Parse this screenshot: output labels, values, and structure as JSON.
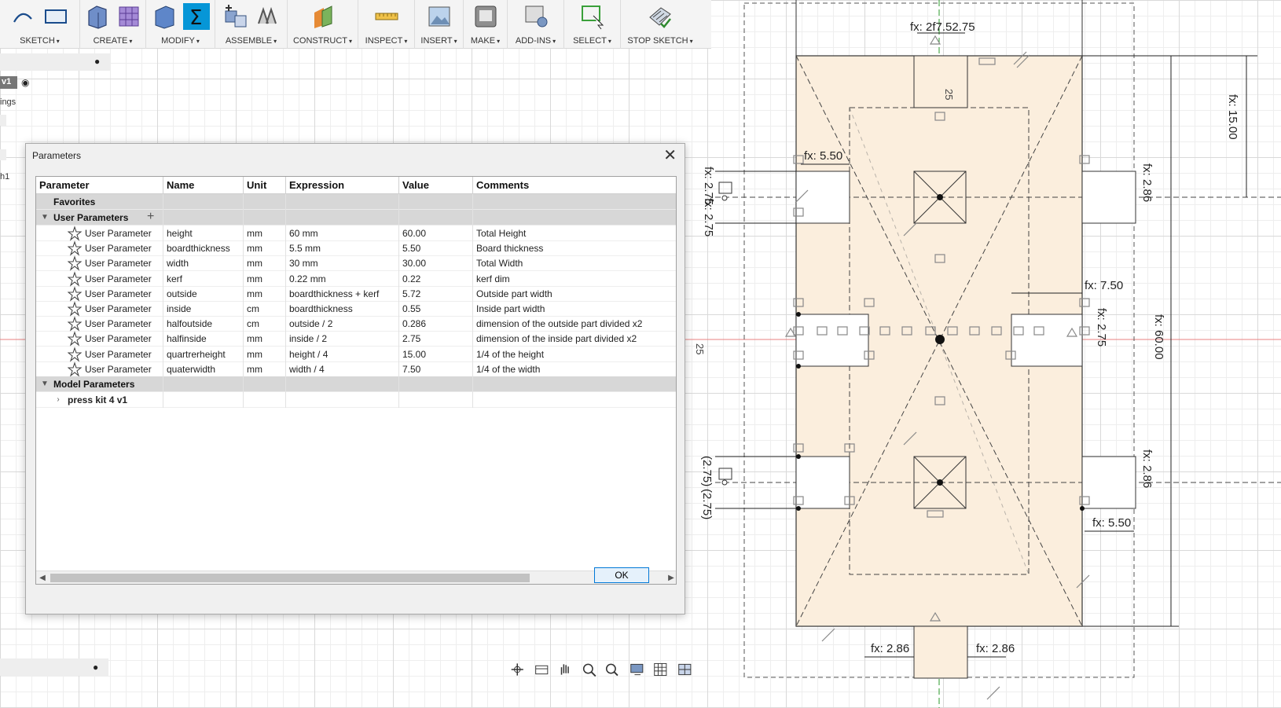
{
  "toolbar": {
    "groups": [
      {
        "label": "SKETCH"
      },
      {
        "label": "CREATE"
      },
      {
        "label": "MODIFY"
      },
      {
        "label": "ASSEMBLE"
      },
      {
        "label": "CONSTRUCT"
      },
      {
        "label": "INSPECT"
      },
      {
        "label": "INSERT"
      },
      {
        "label": "MAKE"
      },
      {
        "label": "ADD-INS"
      },
      {
        "label": "SELECT"
      },
      {
        "label": "STOP SKETCH"
      }
    ],
    "caret": "▾"
  },
  "browser": {
    "item_v1": "v1",
    "item_ings": "ings",
    "item_h1": "h1"
  },
  "dialog": {
    "title": "Parameters",
    "close": "✕",
    "ok_label": "OK",
    "columns": [
      "Parameter",
      "Name",
      "Unit",
      "Expression",
      "Value",
      "Comments"
    ],
    "favorites_label": "Favorites",
    "user_params_label": "User Parameters",
    "model_params_label": "Model Parameters",
    "model_item": "press kit 4 v1",
    "rows": [
      {
        "param": "User Parameter",
        "name": "height",
        "unit": "mm",
        "expr": "60 mm",
        "value": "60.00",
        "comment": "Total Height"
      },
      {
        "param": "User Parameter",
        "name": "boardthickness",
        "unit": "mm",
        "expr": "5.5 mm",
        "value": "5.50",
        "comment": "Board thickness"
      },
      {
        "param": "User Parameter",
        "name": "width",
        "unit": "mm",
        "expr": "30 mm",
        "value": "30.00",
        "comment": "Total Width"
      },
      {
        "param": "User Parameter",
        "name": "kerf",
        "unit": "mm",
        "expr": "0.22 mm",
        "value": "0.22",
        "comment": "kerf dim"
      },
      {
        "param": "User Parameter",
        "name": "outside",
        "unit": "mm",
        "expr": "boardthickness + kerf",
        "value": "5.72",
        "comment": "Outside part width"
      },
      {
        "param": "User Parameter",
        "name": "inside",
        "unit": "cm",
        "expr": "boardthickness",
        "value": "0.55",
        "comment": "Inside part width"
      },
      {
        "param": "User Parameter",
        "name": "halfoutside",
        "unit": "cm",
        "expr": "outside / 2",
        "value": "0.286",
        "comment": "dimension of the outside part divided x2"
      },
      {
        "param": "User Parameter",
        "name": "halfinside",
        "unit": "mm",
        "expr": "inside / 2",
        "value": "2.75",
        "comment": "dimension of the inside part divided x2"
      },
      {
        "param": "User Parameter",
        "name": "quartrerheight",
        "unit": "mm",
        "expr": "height / 4",
        "value": "15.00",
        "comment": "1/4 of the height"
      },
      {
        "param": "User Parameter",
        "name": "quaterwidth",
        "unit": "mm",
        "expr": "width / 4",
        "value": "7.50",
        "comment": "1/4 of the width"
      }
    ]
  },
  "sketch": {
    "dims": {
      "top_width": "fx: 2f7.52.75",
      "right_quarter": "fx: 15.00",
      "right_height": "fx: 60.00",
      "left_outside": "fx: 5.50",
      "left_vert": "fx: 2.75",
      "left_vert2": "fx: 2.75",
      "mid_quarter": "fx: 7.50",
      "mid_vert": "fx: 2.75",
      "right_vert_top": "fx: 2.86",
      "right_vert_bot": "fx: 2.86",
      "right_bottom_outside": "fx: 5.50",
      "bottom_left": "fx: 2.86",
      "bottom_right": "fx: 2.86",
      "paren_a": "(2.75)",
      "paren_b": "(2.75)",
      "tab_25": "25",
      "side_25": "25"
    }
  },
  "colors": {
    "accent": "#0696d7",
    "sketch_fill": "#fbeedd",
    "sketch_line": "#333333",
    "axis_red": "#e05050",
    "axis_green": "#2a9a2a"
  }
}
